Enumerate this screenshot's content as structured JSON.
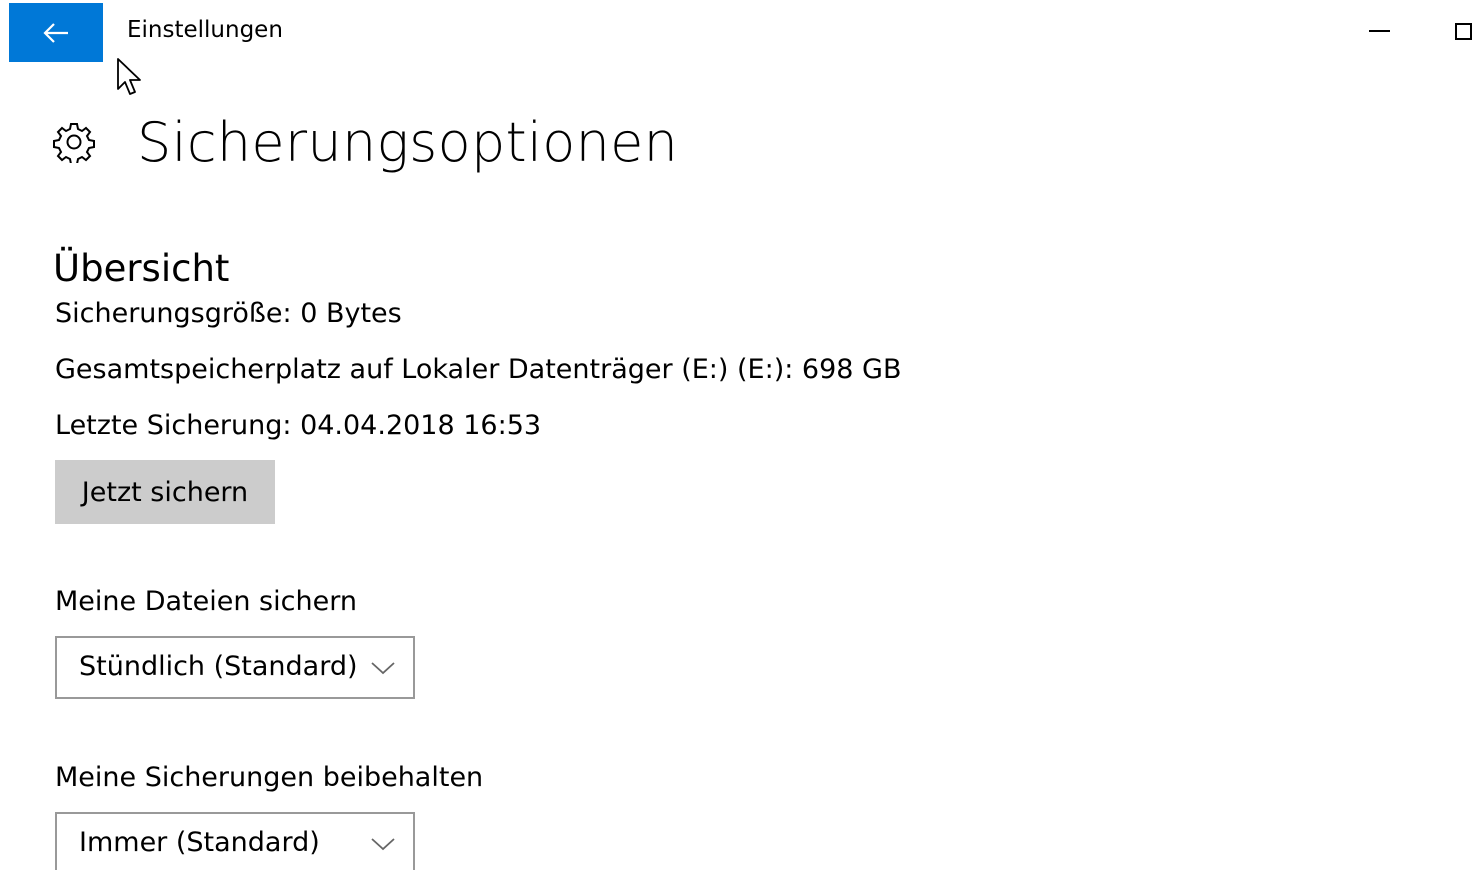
{
  "window": {
    "app_title": "Einstellungen",
    "back_icon": "arrow-left-icon",
    "accent_color": "#0078d7"
  },
  "header": {
    "icon": "gear-icon",
    "title": "Sicherungsoptionen"
  },
  "overview": {
    "heading": "Übersicht",
    "backup_size": "Sicherungsgröße: 0 Bytes",
    "total_space": "Gesamtspeicherplatz auf Lokaler Datenträger (E:) (E:): 698 GB",
    "last_backup": "Letzte Sicherung: 04.04.2018 16:53",
    "backup_now_label": "Jetzt sichern"
  },
  "backup_frequency": {
    "label": "Meine Dateien sichern",
    "selected": "Stündlich (Standard)"
  },
  "retention": {
    "label": "Meine Sicherungen beibehalten",
    "selected": "Immer (Standard)"
  }
}
